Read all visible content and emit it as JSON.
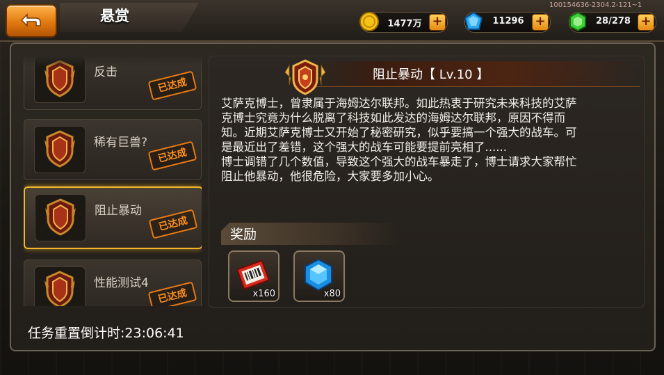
{
  "header": {
    "title": "悬赏",
    "version": "100154636-2304.2-121~1"
  },
  "resources": [
    {
      "name": "gold-coin-icon",
      "value": "1477万"
    },
    {
      "name": "blue-gem-icon",
      "value": "11296"
    },
    {
      "name": "stamina-icon",
      "value": "28/278"
    }
  ],
  "tasks": [
    {
      "name": "反击",
      "status": "已达成"
    },
    {
      "name": "稀有巨兽?",
      "status": "已达成"
    },
    {
      "name": "阻止暴动",
      "status": "已达成",
      "selected": true
    },
    {
      "name": "性能测试4",
      "status": "已达成"
    }
  ],
  "detail": {
    "title": "阻止暴动【 Lv.10 】",
    "description": "艾萨克博士，曾隶属于海姆达尔联邦。如此热衷于研究未来科技的艾萨\n克博士究竟为什么脱离了科技如此发达的海姆达尔联邦，原因不得而\n知。近期艾萨克博士又开始了秘密研究，似乎要搞一个强大的战车。可\n是最近出了差错，这个强大的战车可能要提前亮相了......\n博士调错了几个数值，导致这个强大的战车暴走了，博士请求大家帮忙\n阻止他暴动，他很危险，大家要多加小心。"
  },
  "rewards": {
    "label": "奖励",
    "items": [
      {
        "icon": "ticket-icon",
        "qty": "x160"
      },
      {
        "icon": "blue-crystal-icon",
        "qty": "x80"
      }
    ]
  },
  "footer": {
    "timer": "任务重置倒计时:23:06:41"
  },
  "colors": {
    "accent_orange": "#e87a14",
    "selected_border": "#f2b72a"
  }
}
